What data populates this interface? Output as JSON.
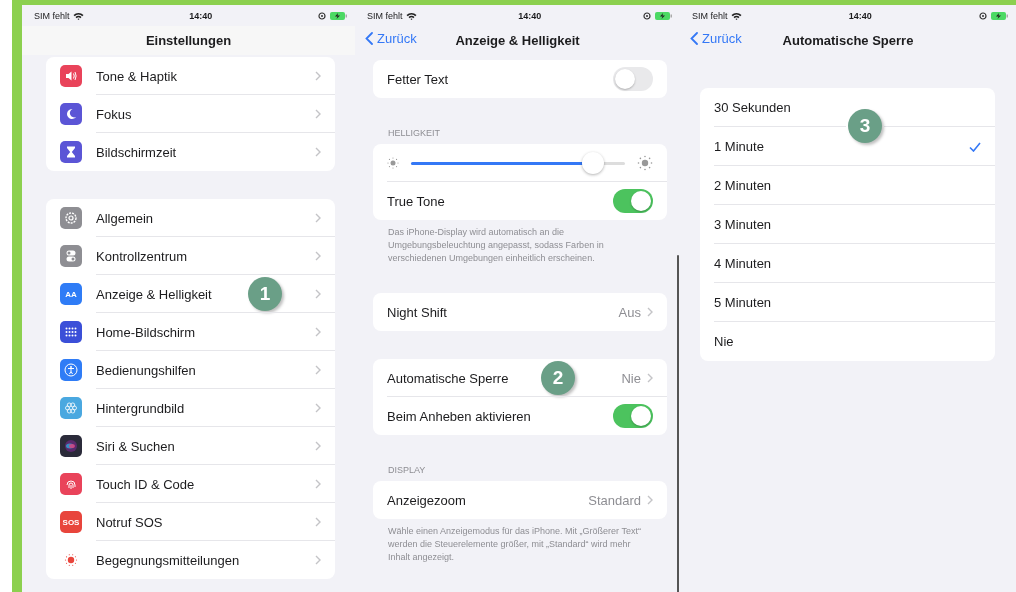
{
  "panels": [
    {
      "status": {
        "carrier": "SIM fehlt",
        "time": "14:40"
      },
      "title": "Einstellungen",
      "groups": [
        {
          "rows": [
            {
              "kind": "link",
              "label": "Tone & Haptik",
              "color": "#e9435a"
            },
            {
              "kind": "link",
              "label": "Fokus",
              "color": "#5b55d6"
            },
            {
              "kind": "link",
              "label": "Bildschirmzeit",
              "color": "#5b55d6"
            }
          ]
        },
        {
          "rows": [
            {
              "kind": "link",
              "label": "Allgemein",
              "color": "#8e8e93"
            },
            {
              "kind": "link",
              "label": "Kontrollzentrum",
              "color": "#8e8e93"
            },
            {
              "kind": "link",
              "label": "Anzeige & Helligkeit",
              "color": "#2f7cf6",
              "icon_label": "AA",
              "badge": "1"
            },
            {
              "kind": "link",
              "label": "Home-Bildschirm",
              "color": "#3b4fd8"
            },
            {
              "kind": "link",
              "label": "Bedienungshilfen",
              "color": "#2f7cf6"
            },
            {
              "kind": "link",
              "label": "Hintergrundbild",
              "color": "#4aa8e0"
            },
            {
              "kind": "link",
              "label": "Siri & Suchen",
              "color": "#2b2b3a"
            },
            {
              "kind": "link",
              "label": "Touch ID & Code",
              "color": "#e9435a"
            },
            {
              "kind": "link",
              "label": "Notruf SOS",
              "color": "#e8453c",
              "icon_label": "SOS"
            },
            {
              "kind": "link",
              "label": "Begegnungsmitteilungen",
              "color": "#ffffff"
            }
          ]
        }
      ]
    },
    {
      "status": {
        "carrier": "SIM fehlt",
        "time": "14:40"
      },
      "back": "Zurück",
      "title": "Anzeige & Helligkeit",
      "groups": [
        {
          "rows": [
            {
              "kind": "toggle",
              "label": "Fetter Text",
              "on": false
            }
          ]
        },
        {
          "header": "HELLIGKEIT",
          "rows": [
            {
              "kind": "slider",
              "level": 0.85
            },
            {
              "kind": "toggle",
              "label": "True Tone",
              "on": true
            }
          ],
          "footer": "Das iPhone-Display wird automatisch an die Umgebungsbeleuchtung angepasst, sodass Farben in verschiedenen Umgebungen einheitlich erscheinen."
        },
        {
          "rows": [
            {
              "kind": "link",
              "label": "Night Shift",
              "value": "Aus"
            }
          ]
        },
        {
          "rows": [
            {
              "kind": "link",
              "label": "Automatische Sperre",
              "value": "Nie",
              "badge": "2"
            },
            {
              "kind": "toggle",
              "label": "Beim Anheben aktivieren",
              "on": true
            }
          ]
        },
        {
          "header": "DISPLAY",
          "rows": [
            {
              "kind": "link",
              "label": "Anzeigezoom",
              "value": "Standard"
            }
          ],
          "footer": "Wähle einen Anzeigemodus für das iPhone. Mit „Größerer Text“ werden die Steuerelemente größer, mit „Standard“ wird mehr Inhalt angezeigt."
        }
      ]
    },
    {
      "status": {
        "carrier": "SIM fehlt",
        "time": "14:40"
      },
      "back": "Zurück",
      "title": "Automatische Sperre",
      "groups": [
        {
          "rows": [
            {
              "kind": "option",
              "label": "30 Sekunden",
              "selected": false,
              "badge": "3"
            },
            {
              "kind": "option",
              "label": "1 Minute",
              "selected": true
            },
            {
              "kind": "option",
              "label": "2 Minuten",
              "selected": false
            },
            {
              "kind": "option",
              "label": "3 Minuten",
              "selected": false
            },
            {
              "kind": "option",
              "label": "4 Minuten",
              "selected": false
            },
            {
              "kind": "option",
              "label": "5 Minuten",
              "selected": false
            },
            {
              "kind": "option",
              "label": "Nie",
              "selected": false
            }
          ]
        }
      ]
    }
  ]
}
